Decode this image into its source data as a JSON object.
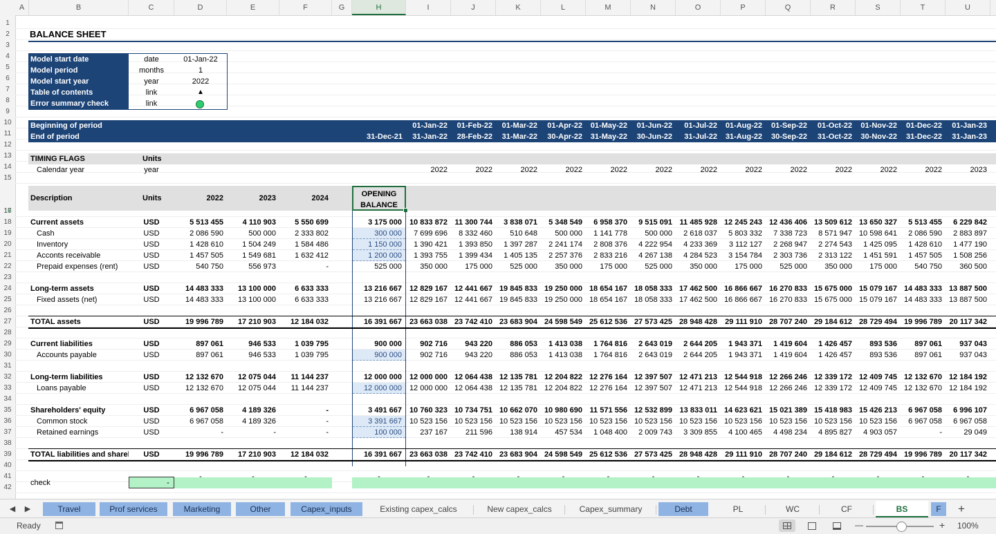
{
  "columns": [
    "A",
    "B",
    "C",
    "D",
    "E",
    "F",
    "G",
    "H",
    "I",
    "J",
    "K",
    "L",
    "M",
    "N",
    "O",
    "P",
    "Q",
    "R",
    "S",
    "T",
    "U"
  ],
  "selected_column": "H",
  "row_numbers": [
    "1",
    "2",
    "3",
    "4",
    "5",
    "6",
    "7",
    "8",
    "9",
    "10",
    "11",
    "12",
    "13",
    "14",
    "15",
    "16",
    "17",
    "18",
    "19",
    "20",
    "21",
    "22",
    "23",
    "24",
    "25",
    "26",
    "27",
    "28",
    "29",
    "30",
    "31",
    "32",
    "33",
    "34",
    "35",
    "36",
    "37",
    "38",
    "39",
    "40",
    "41",
    "42"
  ],
  "selected_row": "16",
  "sheet": {
    "title": "BALANCE SHEET",
    "settings": [
      {
        "label": "Model start date",
        "unit": "date",
        "value": "01-Jan-22"
      },
      {
        "label": "Model period",
        "unit": "months",
        "value": "1"
      },
      {
        "label": "Model start year",
        "unit": "year",
        "value": "2022"
      },
      {
        "label": "Table of contents",
        "unit": "link",
        "value": "▲"
      },
      {
        "label": "Error summary check",
        "unit": "link",
        "value": "●"
      }
    ],
    "period_rows": {
      "beginning_label": "Beginning of period",
      "end_label": "End of period",
      "opening_end": "31-Dec-21",
      "begin_dates": [
        "01-Jan-22",
        "01-Feb-22",
        "01-Mar-22",
        "01-Apr-22",
        "01-May-22",
        "01-Jun-22",
        "01-Jul-22",
        "01-Aug-22",
        "01-Sep-22",
        "01-Oct-22",
        "01-Nov-22",
        "01-Dec-22",
        "01-Jan-23"
      ],
      "end_dates": [
        "31-Jan-22",
        "28-Feb-22",
        "31-Mar-22",
        "30-Apr-22",
        "31-May-22",
        "30-Jun-22",
        "31-Jul-22",
        "31-Aug-22",
        "30-Sep-22",
        "31-Oct-22",
        "30-Nov-22",
        "31-Dec-22",
        "31-Jan-23"
      ]
    },
    "timing": {
      "header": "TIMING FLAGS",
      "units_header": "Units",
      "calendar_label": "Calendar year",
      "calendar_unit": "year",
      "calendar_values": [
        "2022",
        "2022",
        "2022",
        "2022",
        "2022",
        "2022",
        "2022",
        "2022",
        "2022",
        "2022",
        "2022",
        "2022",
        "2023"
      ]
    },
    "table_header": {
      "description": "Description",
      "units": "Units",
      "years": [
        "2022",
        "2023",
        "2024"
      ],
      "opening": [
        "OPENING",
        "BALANCE"
      ]
    },
    "rows": [
      {
        "row": 18,
        "label": "Current assets",
        "bold": true,
        "unit": "USD",
        "annual": [
          "5 513 455",
          "4 110 903",
          "5 550 699"
        ],
        "opening": "3 175 000",
        "monthly": [
          "10 833 872",
          "11 300 744",
          "3 838 071",
          "5 348 549",
          "6 958 370",
          "9 515 091",
          "11 485 928",
          "12 245 243",
          "12 436 406",
          "13 509 612",
          "13 650 327",
          "5 513 455",
          "6 229 842"
        ]
      },
      {
        "row": 19,
        "label": "Cash",
        "indent": true,
        "unit": "USD",
        "annual": [
          "2 086 590",
          "500 000",
          "2 333 802"
        ],
        "opening": "300 000",
        "opening_input": true,
        "monthly": [
          "7 699 696",
          "8 332 460",
          "510 648",
          "500 000",
          "1 141 778",
          "500 000",
          "2 618 037",
          "5 803 332",
          "7 338 723",
          "8 571 947",
          "10 598 641",
          "2 086 590",
          "2 883 897"
        ]
      },
      {
        "row": 20,
        "label": "Inventory",
        "indent": true,
        "unit": "USD",
        "annual": [
          "1 428 610",
          "1 504 249",
          "1 584 486"
        ],
        "opening": "1 150 000",
        "opening_input": true,
        "monthly": [
          "1 390 421",
          "1 393 850",
          "1 397 287",
          "2 241 174",
          "2 808 376",
          "4 222 954",
          "4 233 369",
          "3 112 127",
          "2 268 947",
          "2 274 543",
          "1 425 095",
          "1 428 610",
          "1 477 190"
        ]
      },
      {
        "row": 21,
        "label": "Acconts receivable",
        "indent": true,
        "unit": "USD",
        "annual": [
          "1 457 505",
          "1 549 681",
          "1 632 412"
        ],
        "opening": "1 200 000",
        "opening_input": true,
        "monthly": [
          "1 393 755",
          "1 399 434",
          "1 405 135",
          "2 257 376",
          "2 833 216",
          "4 267 138",
          "4 284 523",
          "3 154 784",
          "2 303 736",
          "2 313 122",
          "1 451 591",
          "1 457 505",
          "1 508 256"
        ]
      },
      {
        "row": 22,
        "label": "Prepaid expenses (rent)",
        "indent": true,
        "unit": "USD",
        "annual": [
          "540 750",
          "556 973",
          "-"
        ],
        "opening": "525 000",
        "monthly": [
          "350 000",
          "175 000",
          "525 000",
          "350 000",
          "175 000",
          "525 000",
          "350 000",
          "175 000",
          "525 000",
          "350 000",
          "175 000",
          "540 750",
          "360 500"
        ]
      },
      {
        "row": 24,
        "label": "Long-term assets",
        "bold": true,
        "unit": "USD",
        "annual": [
          "14 483 333",
          "13 100 000",
          "6 633 333"
        ],
        "opening": "13 216 667",
        "monthly": [
          "12 829 167",
          "12 441 667",
          "19 845 833",
          "19 250 000",
          "18 654 167",
          "18 058 333",
          "17 462 500",
          "16 866 667",
          "16 270 833",
          "15 675 000",
          "15 079 167",
          "14 483 333",
          "13 887 500"
        ]
      },
      {
        "row": 25,
        "label": "Fixed assets (net)",
        "indent": true,
        "unit": "USD",
        "annual": [
          "14 483 333",
          "13 100 000",
          "6 633 333"
        ],
        "opening": "13 216 667",
        "monthly": [
          "12 829 167",
          "12 441 667",
          "19 845 833",
          "19 250 000",
          "18 654 167",
          "18 058 333",
          "17 462 500",
          "16 866 667",
          "16 270 833",
          "15 675 000",
          "15 079 167",
          "14 483 333",
          "13 887 500"
        ]
      },
      {
        "row": 27,
        "label": "TOTAL assets",
        "bold": true,
        "total": true,
        "unit": "USD",
        "annual": [
          "19 996 789",
          "17 210 903",
          "12 184 032"
        ],
        "opening": "16 391 667",
        "monthly": [
          "23 663 038",
          "23 742 410",
          "23 683 904",
          "24 598 549",
          "25 612 536",
          "27 573 425",
          "28 948 428",
          "29 111 910",
          "28 707 240",
          "29 184 612",
          "28 729 494",
          "19 996 789",
          "20 117 342"
        ]
      },
      {
        "row": 29,
        "label": "Current liabilities",
        "bold": true,
        "unit": "USD",
        "annual": [
          "897 061",
          "946 533",
          "1 039 795"
        ],
        "opening": "900 000",
        "monthly": [
          "902 716",
          "943 220",
          "886 053",
          "1 413 038",
          "1 764 816",
          "2 643 019",
          "2 644 205",
          "1 943 371",
          "1 419 604",
          "1 426 457",
          "893 536",
          "897 061",
          "937 043"
        ]
      },
      {
        "row": 30,
        "label": "Accounts payable",
        "indent": true,
        "unit": "USD",
        "annual": [
          "897 061",
          "946 533",
          "1 039 795"
        ],
        "opening": "900 000",
        "opening_input": true,
        "monthly": [
          "902 716",
          "943 220",
          "886 053",
          "1 413 038",
          "1 764 816",
          "2 643 019",
          "2 644 205",
          "1 943 371",
          "1 419 604",
          "1 426 457",
          "893 536",
          "897 061",
          "937 043"
        ]
      },
      {
        "row": 32,
        "label": "Long-term liabilities",
        "bold": true,
        "unit": "USD",
        "annual": [
          "12 132 670",
          "12 075 044",
          "11 144 237"
        ],
        "opening": "12 000 000",
        "monthly": [
          "12 000 000",
          "12 064 438",
          "12 135 781",
          "12 204 822",
          "12 276 164",
          "12 397 507",
          "12 471 213",
          "12 544 918",
          "12 266 246",
          "12 339 172",
          "12 409 745",
          "12 132 670",
          "12 184 192"
        ]
      },
      {
        "row": 33,
        "label": "Loans payable",
        "indent": true,
        "unit": "USD",
        "annual": [
          "12 132 670",
          "12 075 044",
          "11 144 237"
        ],
        "opening": "12 000 000",
        "opening_input": true,
        "monthly": [
          "12 000 000",
          "12 064 438",
          "12 135 781",
          "12 204 822",
          "12 276 164",
          "12 397 507",
          "12 471 213",
          "12 544 918",
          "12 266 246",
          "12 339 172",
          "12 409 745",
          "12 132 670",
          "12 184 192"
        ]
      },
      {
        "row": 35,
        "label": "Shareholders' equity",
        "bold": true,
        "unit": "USD",
        "annual": [
          "6 967 058",
          "4 189 326",
          "-"
        ],
        "opening": "3 491 667",
        "monthly": [
          "10 760 323",
          "10 734 751",
          "10 662 070",
          "10 980 690",
          "11 571 556",
          "12 532 899",
          "13 833 011",
          "14 623 621",
          "15 021 389",
          "15 418 983",
          "15 426 213",
          "6 967 058",
          "6 996 107"
        ]
      },
      {
        "row": 36,
        "label": "Common stock",
        "indent": true,
        "unit": "USD",
        "annual": [
          "6 967 058",
          "4 189 326",
          "-"
        ],
        "opening": "3 391 667",
        "opening_input": true,
        "monthly": [
          "10 523 156",
          "10 523 156",
          "10 523 156",
          "10 523 156",
          "10 523 156",
          "10 523 156",
          "10 523 156",
          "10 523 156",
          "10 523 156",
          "10 523 156",
          "10 523 156",
          "6 967 058",
          "6 967 058"
        ]
      },
      {
        "row": 37,
        "label": "Retained earnings",
        "indent": true,
        "unit": "USD",
        "annual": [
          "-",
          "-",
          "-"
        ],
        "opening": "100 000",
        "opening_input": true,
        "monthly": [
          "237 167",
          "211 596",
          "138 914",
          "457 534",
          "1 048 400",
          "2 009 743",
          "3 309 855",
          "4 100 465",
          "4 498 234",
          "4 895 827",
          "4 903 057",
          "-",
          "29 049"
        ]
      },
      {
        "row": 39,
        "label": "TOTAL liabilities and shareho",
        "bold": true,
        "total": true,
        "unit": "USD",
        "annual": [
          "19 996 789",
          "17 210 903",
          "12 184 032"
        ],
        "opening": "16 391 667",
        "monthly": [
          "23 663 038",
          "23 742 410",
          "23 683 904",
          "24 598 549",
          "25 612 536",
          "27 573 425",
          "28 948 428",
          "29 111 910",
          "28 707 240",
          "29 184 612",
          "28 729 494",
          "19 996 789",
          "20 117 342"
        ]
      }
    ],
    "check": {
      "label": "check",
      "value": "-"
    }
  },
  "tabs": {
    "items": [
      {
        "label": "Travel",
        "colored": true
      },
      {
        "label": "Prof services",
        "colored": true
      },
      {
        "label": "Marketing",
        "colored": true
      },
      {
        "label": "Other",
        "colored": true
      },
      {
        "label": "Capex_inputs",
        "colored": true
      },
      {
        "label": "Existing capex_calcs",
        "colored": false
      },
      {
        "label": "New capex_calcs",
        "colored": false
      },
      {
        "label": "Capex_summary",
        "colored": false
      },
      {
        "label": "Debt",
        "colored": true
      },
      {
        "label": "PL",
        "colored": false
      },
      {
        "label": "WC",
        "colored": false
      },
      {
        "label": "CF",
        "colored": false
      },
      {
        "label": "BS",
        "colored": false,
        "active": true
      },
      {
        "label": "F",
        "colored": true
      }
    ],
    "prev_glyph": "◀",
    "next_glyph": "▶",
    "add_glyph": "+"
  },
  "status": {
    "ready": "Ready",
    "zoom": "100%",
    "minus": "—",
    "plus": "+"
  },
  "colors": {
    "navy": "#1d4477",
    "input_blue": "#dde9f6",
    "check_green": "#b2f2c6",
    "selection_green": "#1f6f3e",
    "tab_blue": "#8fb4e3",
    "ok_green": "#2ecc71"
  }
}
